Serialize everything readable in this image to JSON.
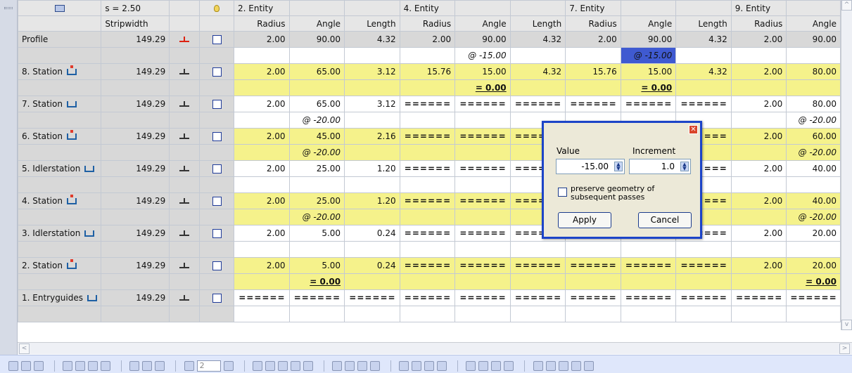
{
  "header_row1": {
    "strip_label": "s = 2.50",
    "entity_2": "2. Entity",
    "entity_4": "4. Entity",
    "entity_7": "7. Entity",
    "entity_9": "9. Entity"
  },
  "header_row2": {
    "stripwidth": "Stripwidth",
    "radius": "Radius",
    "angle": "Angle",
    "length": "Length"
  },
  "profile_row": {
    "label": "Profile",
    "stripwidth": "149.29",
    "values": [
      "2.00",
      "90.00",
      "4.32",
      "2.00",
      "90.00",
      "4.32",
      "2.00",
      "90.00",
      "4.32",
      "2.00",
      "90.00"
    ]
  },
  "profile_sub": {
    "v4": "@ -15.00",
    "v7": "@ -15.00"
  },
  "stations": [
    {
      "label": "8. Station",
      "stripwidth": "149.29",
      "values": [
        "2.00",
        "65.00",
        "3.12",
        "15.76",
        "15.00",
        "4.32",
        "15.76",
        "15.00",
        "4.32",
        "2.00",
        "80.00"
      ],
      "sub": {
        "c4": "= 0.00",
        "c7": "= 0.00"
      }
    },
    {
      "label": "7. Station",
      "stripwidth": "149.29",
      "values": [
        "2.00",
        "65.00",
        "3.12",
        "======",
        "======",
        "======",
        "======",
        "======",
        "======",
        "2.00",
        "80.00"
      ],
      "sub": {
        "c1": "@ -20.00",
        "c10": "@ -20.00"
      }
    },
    {
      "label": "6. Station",
      "stripwidth": "149.29",
      "values": [
        "2.00",
        "45.00",
        "2.16",
        "======",
        "======",
        "======",
        "",
        "",
        "===",
        "2.00",
        "60.00"
      ],
      "sub": {
        "c1": "@ -20.00",
        "c10": "@ -20.00"
      }
    },
    {
      "label": "5. Idlerstation",
      "stripwidth": "149.29",
      "values": [
        "2.00",
        "25.00",
        "1.20",
        "======",
        "======",
        "======",
        "",
        "",
        "===",
        "2.00",
        "40.00"
      ],
      "sub": {}
    },
    {
      "label": "4. Station",
      "stripwidth": "149.29",
      "values": [
        "2.00",
        "25.00",
        "1.20",
        "======",
        "======",
        "======",
        "",
        "",
        "===",
        "2.00",
        "40.00"
      ],
      "sub": {
        "c1": "@ -20.00",
        "c10": "@ -20.00"
      }
    },
    {
      "label": "3. Idlerstation",
      "stripwidth": "149.29",
      "values": [
        "2.00",
        "5.00",
        "0.24",
        "======",
        "======",
        "======",
        "======",
        "======",
        "======",
        "2.00",
        "20.00"
      ],
      "sub": {}
    },
    {
      "label": "2. Station",
      "stripwidth": "149.29",
      "values": [
        "2.00",
        "5.00",
        "0.24",
        "======",
        "======",
        "======",
        "======",
        "======",
        "======",
        "2.00",
        "20.00"
      ],
      "sub": {
        "c1": "= 0.00",
        "c10": "= 0.00"
      }
    },
    {
      "label": "1. Entryguides",
      "stripwidth": "149.29",
      "values": [
        "======",
        "======",
        "======",
        "======",
        "======",
        "======",
        "======",
        "======",
        "======",
        "======",
        "======"
      ],
      "sub": {}
    }
  ],
  "dialog": {
    "value_label": "Value",
    "increment_label": "Increment",
    "value": "-15.00",
    "increment": "1.0",
    "preserve": "preserve geometry of subsequent passes",
    "apply": "Apply",
    "cancel": "Cancel",
    "close": "✕"
  },
  "toolbar": {
    "select_value": "2"
  },
  "colors": {
    "yellow": "#f5f28b",
    "selected": "#3f5ad1",
    "red_text": "#dd1111",
    "dialog_border": "#1c44c8"
  }
}
